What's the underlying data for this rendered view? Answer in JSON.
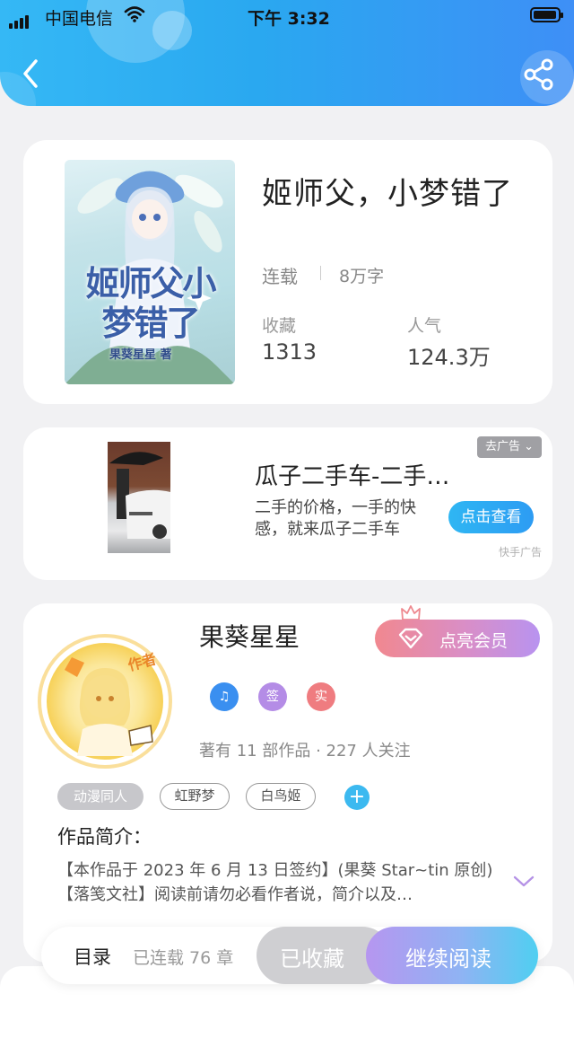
{
  "status_bar": {
    "carrier": "中国电信",
    "time": "下午 3:32",
    "battery_level": 0.95
  },
  "header": {
    "back_icon": "chevron-left-icon",
    "share_icon": "share-icon",
    "background_color": "#2aa8f0"
  },
  "book": {
    "cover_title": "姬师父小梦错了",
    "cover_author": "果葵星星 著",
    "title": "姬师父，小梦错了",
    "status": "连载",
    "word_count": "8万字",
    "collect_label": "收藏",
    "collect_value": "1313",
    "popularity_label": "人气",
    "popularity_value": "124.3万"
  },
  "ad": {
    "tag": "去广告 ⌄",
    "title": "瓜子二手车-二手…",
    "description": "二手的价格，一手的快感，就来瓜子二手车",
    "button": "点击查看",
    "source": "快手广告"
  },
  "author": {
    "badge_text": "作者",
    "name": "果葵星星",
    "vip_button": "点亮会员",
    "badges": [
      {
        "label": "♫",
        "color": "#3a8ff0"
      },
      {
        "label": "签",
        "color": "#b48ce6"
      },
      {
        "label": "实",
        "color": "#ef7c80"
      }
    ],
    "meta": "著有 11 部作品 · 227 人关注",
    "tags": [
      "动漫同人",
      "虹野梦",
      "白鸟姬"
    ],
    "intro_label": "作品简介：",
    "intro_text": "【本作品于 2023 年 6 月 13 日签约】(果葵 Star~tin 原创)【落笺文社】阅读前请勿必看作者说，简介以及…"
  },
  "bottom_bar": {
    "toc": "目录",
    "chapter_count": "已连载 76 章",
    "collected": "已收藏",
    "continue_reading": "继续阅读"
  }
}
